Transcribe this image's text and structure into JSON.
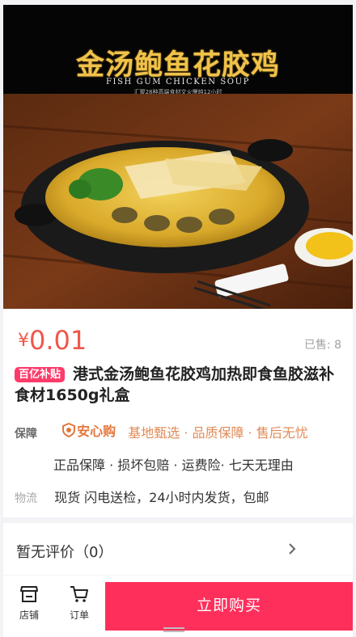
{
  "hero": {
    "title": "金汤鲍鱼花胶鸡",
    "subtitle_en": "FISH GUM CHICKEN SOUP",
    "tagline": "汇聚28种高端食材文火慢炖12小时"
  },
  "product": {
    "price_symbol": "¥",
    "price": "0.01",
    "sold_label": "已售: 8",
    "badge": "百亿补贴",
    "title": "港式金汤鲍鱼花胶鸡加热即食鱼胶滋补食材1650g礼盒"
  },
  "guarantee": {
    "label": "保障",
    "brand": "安心购",
    "highlights": "基地甄选 · 品质保障 · 售后无忧",
    "details": "正品保障 · 损坏包赔 · 运费险· 七天无理由"
  },
  "logistics": {
    "label": "物流",
    "text": "现货 闪电送检，24小时内发货，包邮"
  },
  "reviews": {
    "label": "暂无评价（0）"
  },
  "bottom_bar": {
    "shop_label": "店铺",
    "orders_label": "订单",
    "buy_label": "立即购买"
  },
  "colors": {
    "price": "#f0574a",
    "buy_button": "#ff2f5c",
    "badge": "#ff3b6a",
    "guarantee_text": "#e08a56"
  }
}
